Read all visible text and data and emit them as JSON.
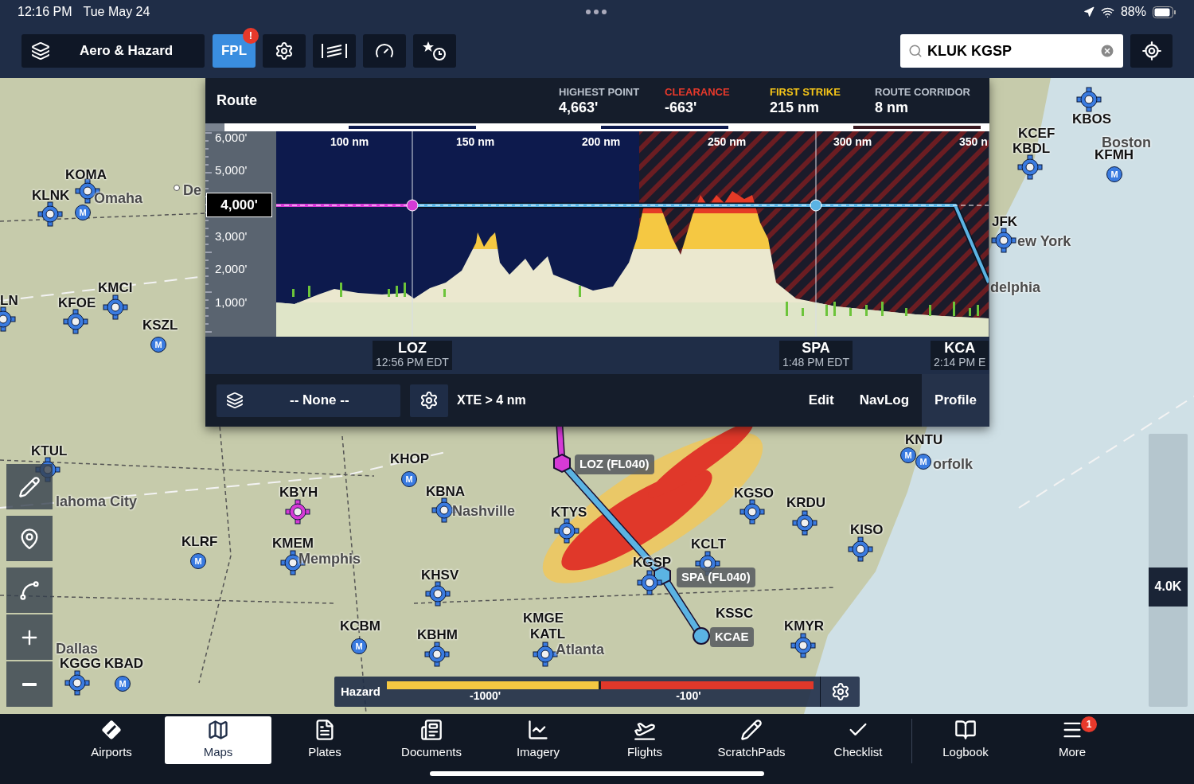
{
  "status_bar": {
    "time": "12:16 PM",
    "date": "Tue May 24",
    "battery": "88%"
  },
  "toolbar": {
    "layer_button": "Aero & Hazard",
    "fpl": {
      "label": "FPL",
      "badge": "!",
      "selected": true
    },
    "search": {
      "value": "KLUK KGSP"
    }
  },
  "route_panel": {
    "title": "Route",
    "stats": [
      {
        "label": "HIGHEST POINT",
        "value": "4,663'",
        "color": "#b9c1cc"
      },
      {
        "label": "CLEARANCE",
        "value": "-663'",
        "color": "#e8392b"
      },
      {
        "label": "FIRST STRIKE",
        "value": "215 nm",
        "color": "#f5c518"
      },
      {
        "label": "ROUTE CORRIDOR",
        "value": "8 nm",
        "color": "#b9c1cc"
      }
    ],
    "distance_ticks": [
      "100 nm",
      "150 nm",
      "200 nm",
      "250 nm",
      "300 nm",
      "350 n"
    ],
    "altitude_ticks": [
      "6,000'",
      "5,000'",
      "3,000'",
      "2,000'",
      "1,000'"
    ],
    "altitude_marker": "4,000'",
    "waypoints": [
      {
        "name": "LOZ",
        "time": "12:56 PM EDT"
      },
      {
        "name": "SPA",
        "time": "1:48 PM EDT"
      },
      {
        "name": "KCA",
        "time": "2:14 PM E"
      }
    ],
    "layer_select": "-- None --",
    "xte": "XTE > 4 nm",
    "tabs": [
      {
        "label": "Edit",
        "selected": false
      },
      {
        "label": "NavLog",
        "selected": false
      },
      {
        "label": "Profile",
        "selected": true
      }
    ]
  },
  "map": {
    "places": [
      {
        "name": "KOMA",
        "kind": "airport",
        "marker": {
          "kind": "crosshair"
        }
      },
      {
        "name": "KLNK",
        "kind": "airport",
        "marker": {
          "kind": "crosshair"
        }
      },
      {
        "name": "Omaha",
        "kind": "city",
        "marker": {
          "kind": "m",
          "label": "M"
        }
      },
      {
        "name": "De",
        "kind": "city",
        "marker": {
          "kind": "dot"
        }
      },
      {
        "name": "KMCI",
        "kind": "airport",
        "marker": {
          "kind": "crosshair"
        }
      },
      {
        "name": "KFOE",
        "kind": "airport",
        "marker": {
          "kind": "crosshair"
        }
      },
      {
        "name": "KSZL",
        "kind": "airport",
        "marker": {
          "kind": "m",
          "label": "M"
        }
      },
      {
        "name": "LN",
        "kind": "airport",
        "marker": {
          "kind": "crosshair"
        }
      },
      {
        "name": "KTUL",
        "kind": "airport",
        "marker": {
          "kind": "crosshair"
        }
      },
      {
        "name": "lahoma City",
        "kind": "city"
      },
      {
        "name": "KBYH",
        "kind": "airport",
        "marker": {
          "kind": "magenta"
        }
      },
      {
        "name": "KLRF",
        "kind": "airport",
        "marker": {
          "kind": "m",
          "label": "M"
        }
      },
      {
        "name": "KMEM",
        "kind": "airport",
        "marker": {
          "kind": "crosshair"
        }
      },
      {
        "name": "Memphis",
        "kind": "city"
      },
      {
        "name": "KHOP",
        "kind": "airport",
        "marker": {
          "kind": "m",
          "label": "M"
        }
      },
      {
        "name": "KBNA",
        "kind": "airport",
        "marker": {
          "kind": "crosshair"
        }
      },
      {
        "name": "Nashville",
        "kind": "city"
      },
      {
        "name": "KTYS",
        "kind": "airport",
        "marker": {
          "kind": "crosshair"
        }
      },
      {
        "name": "KHSV",
        "kind": "airport",
        "marker": {
          "kind": "crosshair"
        }
      },
      {
        "name": "KCBM",
        "kind": "airport",
        "marker": {
          "kind": "m",
          "label": "M"
        }
      },
      {
        "name": "KBHM",
        "kind": "airport",
        "marker": {
          "kind": "crosshair"
        }
      },
      {
        "name": "KMGE",
        "kind": "airport"
      },
      {
        "name": "KATL",
        "kind": "airport",
        "marker": {
          "kind": "crosshair"
        }
      },
      {
        "name": "Atlanta",
        "kind": "city"
      },
      {
        "name": "KGSO",
        "kind": "airport",
        "marker": {
          "kind": "crosshair"
        }
      },
      {
        "name": "KRDU",
        "kind": "airport",
        "marker": {
          "kind": "crosshair"
        }
      },
      {
        "name": "KISO",
        "kind": "airport",
        "marker": {
          "kind": "crosshair"
        }
      },
      {
        "name": "KCLT",
        "kind": "airport",
        "marker": {
          "kind": "crosshair"
        }
      },
      {
        "name": "KGSP",
        "kind": "airport",
        "marker": {
          "kind": "crosshair"
        }
      },
      {
        "name": "KSSC",
        "kind": "airport"
      },
      {
        "name": "KMYR",
        "kind": "airport",
        "marker": {
          "kind": "crosshair"
        }
      },
      {
        "name": "KGGG",
        "kind": "airport",
        "marker": {
          "kind": "crosshair"
        }
      },
      {
        "name": "KBAD",
        "kind": "airport",
        "marker": {
          "kind": "m",
          "label": "M"
        }
      },
      {
        "name": "Dallas",
        "kind": "city"
      },
      {
        "name": "KNTU",
        "kind": "airport",
        "marker": {
          "kind": "m",
          "label": "M"
        }
      },
      {
        "name": "orfolk",
        "kind": "city",
        "marker": {
          "kind": "m",
          "label": "M"
        }
      },
      {
        "name": "KBOS",
        "kind": "airport",
        "marker": {
          "kind": "crosshair"
        }
      },
      {
        "name": "Boston",
        "kind": "city"
      },
      {
        "name": "KCEF",
        "kind": "airport"
      },
      {
        "name": "KBDL",
        "kind": "airport",
        "marker": {
          "kind": "crosshair"
        }
      },
      {
        "name": "KFMH",
        "kind": "airport",
        "marker": {
          "kind": "m",
          "label": "M"
        }
      },
      {
        "name": "JFK",
        "kind": "airport",
        "marker": {
          "kind": "crosshair"
        }
      },
      {
        "name": "ew York",
        "kind": "city"
      },
      {
        "name": "delphia",
        "kind": "city"
      }
    ],
    "route_labels": [
      "LOZ (FL040)",
      "SPA (FL040)",
      "KCAE"
    ],
    "hazard_legend": {
      "title": "Hazard",
      "ticks": [
        "-1000'",
        "-100'"
      ]
    },
    "altitude_slider": {
      "level": 0.43,
      "reading": "4.0K"
    }
  },
  "tab_bar": [
    {
      "label": "Airports",
      "selected": false
    },
    {
      "label": "Maps",
      "selected": true
    },
    {
      "label": "Plates",
      "selected": false
    },
    {
      "label": "Documents",
      "selected": false
    },
    {
      "label": "Imagery",
      "selected": false
    },
    {
      "label": "Flights",
      "selected": false
    },
    {
      "label": "ScratchPads",
      "selected": false
    },
    {
      "label": "Checklist",
      "selected": false
    },
    {
      "label": "Logbook",
      "selected": false
    },
    {
      "label": "More",
      "selected": false,
      "badge": "1"
    }
  ]
}
